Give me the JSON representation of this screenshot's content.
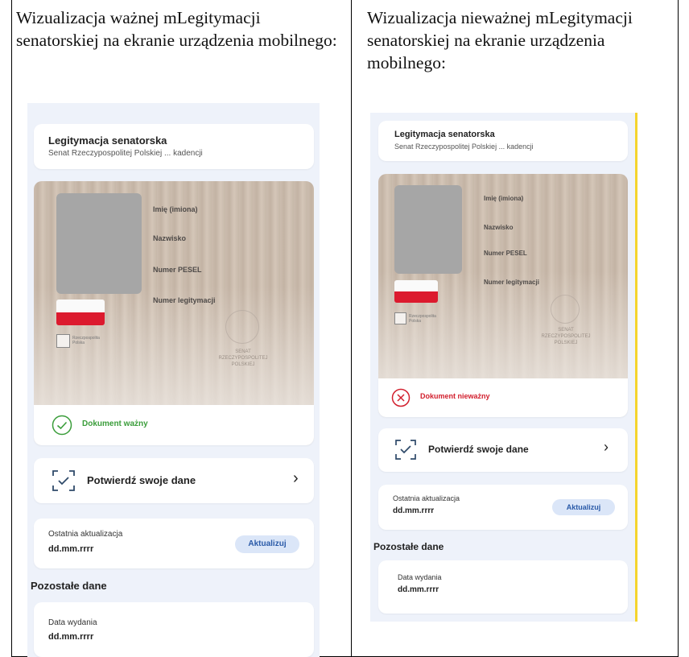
{
  "headings": {
    "left": "Wizualizacja ważnej mLegitymacji senatorskiej na ekranie urządzenia mobilnego:",
    "right": "Wizualizacja nieważnej mLegitymacji senatorskiej na ekranie urządzenia mobilnego:"
  },
  "card": {
    "title": "Legitymacja senatorska",
    "subtitle": "Senat Rzeczypospolitej Polskiej ... kadencji",
    "fields": [
      "Imię (imiona)",
      "Nazwisko",
      "Numer PESEL",
      "Numer legitymacji"
    ],
    "emblem_caption": "Rzeczpospolita Polska",
    "watermark": "SENAT RZECZYPOSPOLITEJ POLSKIEJ"
  },
  "status": {
    "valid": "Dokument ważny",
    "invalid": "Dokument nieważny",
    "valid_color": "#3a9d3a",
    "invalid_color": "#d21f2d"
  },
  "confirm": {
    "label": "Potwierdź swoje dane",
    "icon": "scan-frame-icon",
    "arrow": "chevron-right-icon"
  },
  "update": {
    "label": "Ostatnia aktualizacja",
    "value": "dd.mm.rrrr",
    "button": "Aktualizuj"
  },
  "other": {
    "section": "Pozostałe dane",
    "label": "Data wydania",
    "value": "dd.mm.rrrr"
  }
}
